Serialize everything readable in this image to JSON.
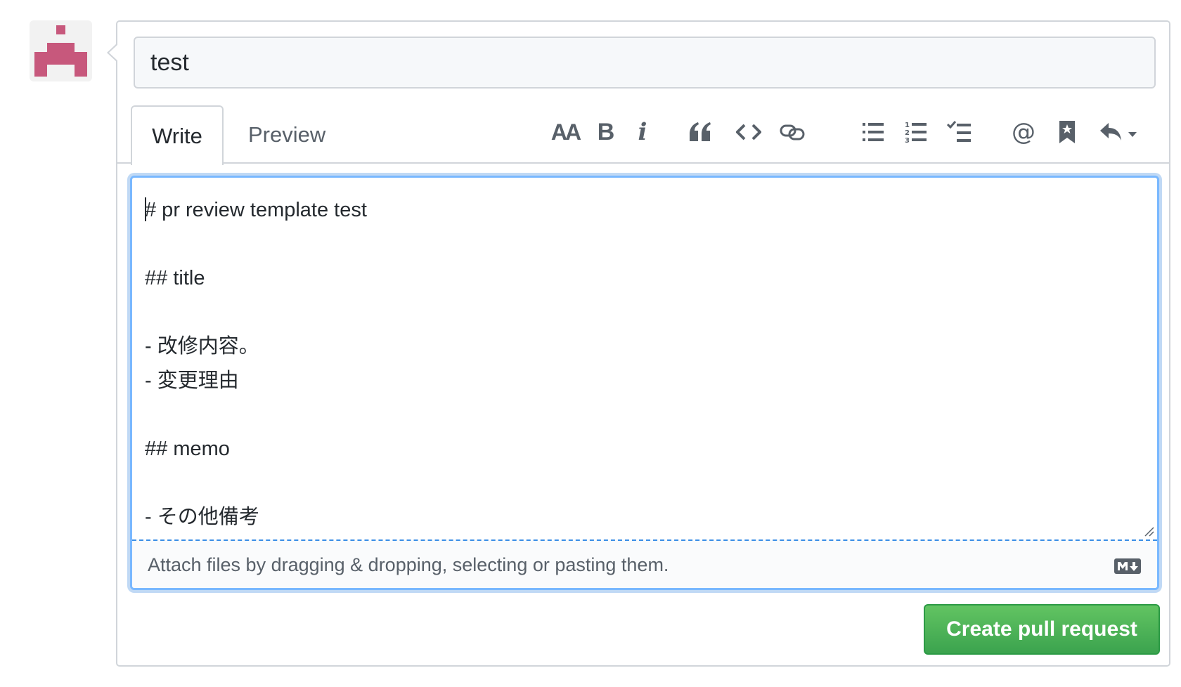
{
  "avatar": {
    "icon": "identicon-avatar",
    "color": "#c7587c"
  },
  "title_field": {
    "value": "test"
  },
  "tabs": [
    {
      "label": "Write",
      "active": true
    },
    {
      "label": "Preview",
      "active": false
    }
  ],
  "toolbar": {
    "heading_glyph": "AA",
    "bold_glyph": "B",
    "italic_glyph": "i",
    "icons": [
      "text-size-icon",
      "bold-icon",
      "italic-icon",
      "quote-icon",
      "code-icon",
      "link-icon",
      "unordered-list-icon",
      "ordered-list-icon",
      "task-list-icon",
      "mention-icon",
      "bookmark-icon",
      "reply-icon"
    ]
  },
  "body": {
    "content": "# pr review template test\n\n## title\n\n- 改修内容。\n- 変更理由\n\n## memo\n\n- その他備考"
  },
  "attach_hint": "Attach files by dragging & dropping, selecting or pasting them.",
  "submit": {
    "label": "Create pull request",
    "color": "#28a745"
  },
  "colors": {
    "focus_border": "#79b8ff",
    "border": "#d1d5da",
    "muted_text": "#586069"
  }
}
